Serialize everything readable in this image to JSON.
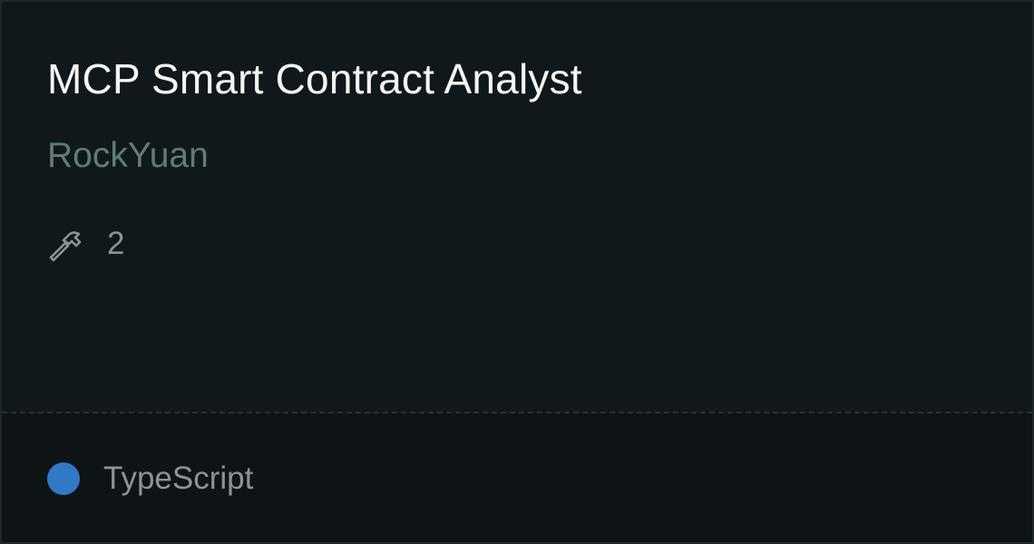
{
  "card": {
    "title": "MCP Smart Contract Analyst",
    "author": "RockYuan",
    "tools": {
      "icon": "hammer-icon",
      "count": "2"
    },
    "language": {
      "name": "TypeScript",
      "color": "#3178c6"
    }
  },
  "colors": {
    "background": "#11181b",
    "footer_background": "#0e1316",
    "title": "#f4f6f6",
    "author": "#5f7c78",
    "muted_text": "#8a9497"
  }
}
